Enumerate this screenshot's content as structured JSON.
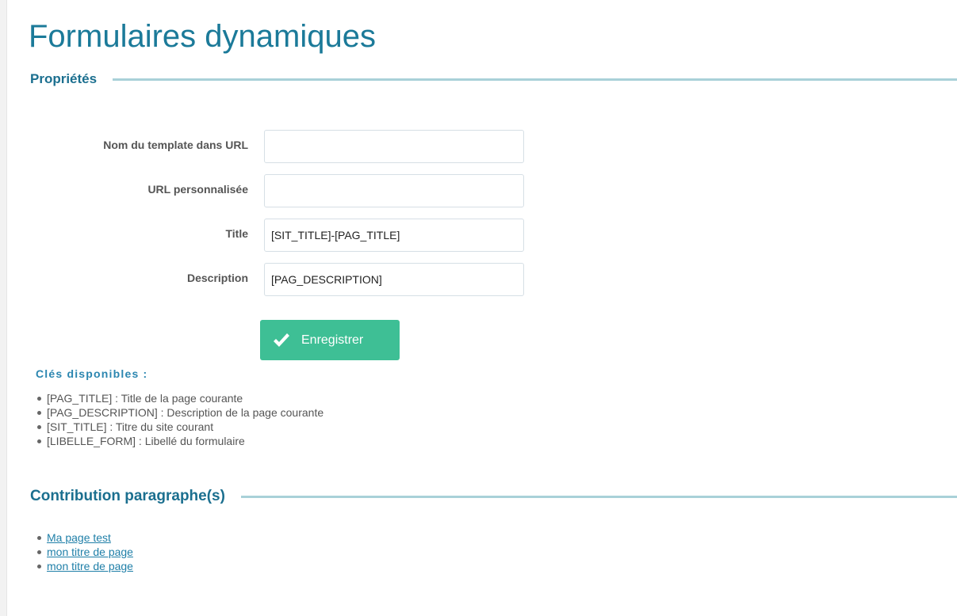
{
  "page": {
    "title": "Formulaires dynamiques"
  },
  "properties": {
    "header": "Propriétés",
    "fields": {
      "template_url_name": {
        "label": "Nom du template dans URL",
        "value": ""
      },
      "custom_url": {
        "label": "URL personnalisée",
        "value": ""
      },
      "title": {
        "label": "Title",
        "value": "[SIT_TITLE]-[PAG_TITLE]"
      },
      "description": {
        "label": "Description",
        "value": "[PAG_DESCRIPTION]"
      }
    },
    "save_button": {
      "label": "Enregistrer",
      "icon": "checkmark-icon",
      "color": "#3ebf95"
    }
  },
  "keys": {
    "title": "Clés disponibles :",
    "items": [
      "[PAG_TITLE] : Title de la page courante",
      "[PAG_DESCRIPTION] : Description de la page courante",
      "[SIT_TITLE] : Titre du site courant",
      "[LIBELLE_FORM] : Libellé du formulaire"
    ]
  },
  "contribution": {
    "header": "Contribution paragraphe(s)",
    "links": [
      "Ma page test",
      "mon titre de page",
      "mon titre de page"
    ]
  },
  "colors": {
    "title": "#1b7a99",
    "section_header": "#1b6f8f",
    "section_rule": "#a9d1d8",
    "link": "#1f7fa8",
    "keys_title": "#2b86b0"
  }
}
